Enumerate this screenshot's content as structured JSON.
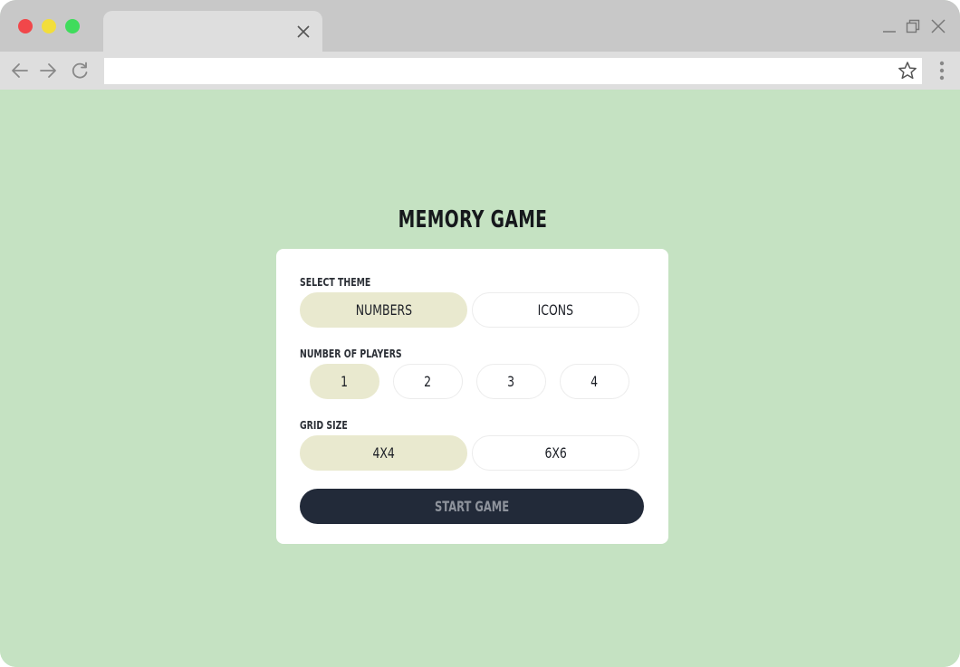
{
  "browser": {
    "traffic_colors": {
      "close": "#f1474a",
      "minimize": "#f2de3b",
      "zoom": "#3fdc5c"
    },
    "tab": {
      "title": "",
      "close_icon": "close-icon"
    },
    "address_bar": {
      "value": "",
      "placeholder": ""
    },
    "icons": [
      "back-arrow-icon",
      "forward-arrow-icon",
      "reload-icon",
      "star-icon",
      "kebab-menu-icon",
      "window-minimize-icon",
      "window-restore-icon",
      "window-close-icon"
    ]
  },
  "page": {
    "background": "#c5e2c2",
    "title": "MEMORY GAME",
    "theme": {
      "label": "SELECT THEME",
      "options": [
        "NUMBERS",
        "ICONS"
      ],
      "selected": "NUMBERS"
    },
    "players": {
      "label": "NUMBER OF PLAYERS",
      "options": [
        "1",
        "2",
        "3",
        "4"
      ],
      "selected": "1"
    },
    "grid": {
      "label": "GRID SIZE",
      "options": [
        "4X4",
        "6X6"
      ],
      "selected": "4X4"
    },
    "start_button": "START GAME",
    "colors": {
      "selected_option": "#e9e9cf",
      "start_button": "#222a39",
      "start_text": "#8e939c"
    }
  }
}
